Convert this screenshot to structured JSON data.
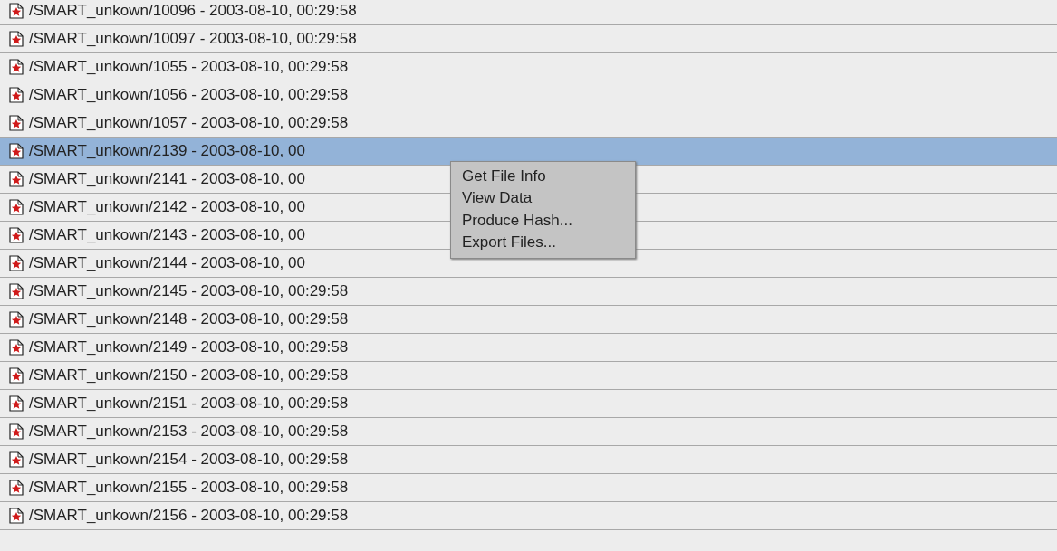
{
  "files": [
    {
      "path": "/SMART_unkown/10096 - 2003-08-10, 00:29:58",
      "selected": false
    },
    {
      "path": "/SMART_unkown/10097 - 2003-08-10, 00:29:58",
      "selected": false
    },
    {
      "path": "/SMART_unkown/1055 - 2003-08-10, 00:29:58",
      "selected": false
    },
    {
      "path": "/SMART_unkown/1056 - 2003-08-10, 00:29:58",
      "selected": false
    },
    {
      "path": "/SMART_unkown/1057 - 2003-08-10, 00:29:58",
      "selected": false
    },
    {
      "path": "/SMART_unkown/2139 - 2003-08-10, 00",
      "selected": true
    },
    {
      "path": "/SMART_unkown/2141 - 2003-08-10, 00",
      "selected": false
    },
    {
      "path": "/SMART_unkown/2142 - 2003-08-10, 00",
      "selected": false
    },
    {
      "path": "/SMART_unkown/2143 - 2003-08-10, 00",
      "selected": false
    },
    {
      "path": "/SMART_unkown/2144 - 2003-08-10, 00",
      "selected": false
    },
    {
      "path": "/SMART_unkown/2145 - 2003-08-10, 00:29:58",
      "selected": false
    },
    {
      "path": "/SMART_unkown/2148 - 2003-08-10, 00:29:58",
      "selected": false
    },
    {
      "path": "/SMART_unkown/2149 - 2003-08-10, 00:29:58",
      "selected": false
    },
    {
      "path": "/SMART_unkown/2150 - 2003-08-10, 00:29:58",
      "selected": false
    },
    {
      "path": "/SMART_unkown/2151 - 2003-08-10, 00:29:58",
      "selected": false
    },
    {
      "path": "/SMART_unkown/2153 - 2003-08-10, 00:29:58",
      "selected": false
    },
    {
      "path": "/SMART_unkown/2154 - 2003-08-10, 00:29:58",
      "selected": false
    },
    {
      "path": "/SMART_unkown/2155 - 2003-08-10, 00:29:58",
      "selected": false
    },
    {
      "path": "/SMART_unkown/2156 - 2003-08-10, 00:29:58",
      "selected": false
    }
  ],
  "context_menu": {
    "items": [
      "Get File Info",
      "View Data",
      "Produce Hash...",
      "Export Files..."
    ]
  }
}
